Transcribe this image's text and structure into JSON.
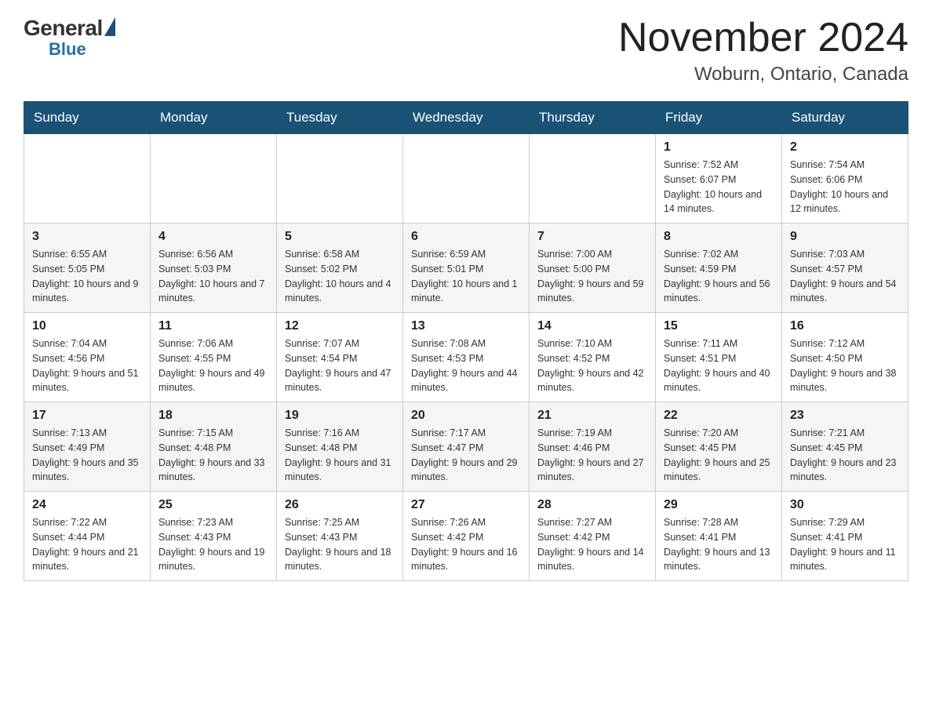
{
  "logo": {
    "general": "General",
    "blue": "Blue"
  },
  "title": {
    "month_year": "November 2024",
    "location": "Woburn, Ontario, Canada"
  },
  "weekdays": [
    "Sunday",
    "Monday",
    "Tuesday",
    "Wednesday",
    "Thursday",
    "Friday",
    "Saturday"
  ],
  "weeks": [
    [
      {
        "day": "",
        "info": ""
      },
      {
        "day": "",
        "info": ""
      },
      {
        "day": "",
        "info": ""
      },
      {
        "day": "",
        "info": ""
      },
      {
        "day": "",
        "info": ""
      },
      {
        "day": "1",
        "info": "Sunrise: 7:52 AM\nSunset: 6:07 PM\nDaylight: 10 hours and 14 minutes."
      },
      {
        "day": "2",
        "info": "Sunrise: 7:54 AM\nSunset: 6:06 PM\nDaylight: 10 hours and 12 minutes."
      }
    ],
    [
      {
        "day": "3",
        "info": "Sunrise: 6:55 AM\nSunset: 5:05 PM\nDaylight: 10 hours and 9 minutes."
      },
      {
        "day": "4",
        "info": "Sunrise: 6:56 AM\nSunset: 5:03 PM\nDaylight: 10 hours and 7 minutes."
      },
      {
        "day": "5",
        "info": "Sunrise: 6:58 AM\nSunset: 5:02 PM\nDaylight: 10 hours and 4 minutes."
      },
      {
        "day": "6",
        "info": "Sunrise: 6:59 AM\nSunset: 5:01 PM\nDaylight: 10 hours and 1 minute."
      },
      {
        "day": "7",
        "info": "Sunrise: 7:00 AM\nSunset: 5:00 PM\nDaylight: 9 hours and 59 minutes."
      },
      {
        "day": "8",
        "info": "Sunrise: 7:02 AM\nSunset: 4:59 PM\nDaylight: 9 hours and 56 minutes."
      },
      {
        "day": "9",
        "info": "Sunrise: 7:03 AM\nSunset: 4:57 PM\nDaylight: 9 hours and 54 minutes."
      }
    ],
    [
      {
        "day": "10",
        "info": "Sunrise: 7:04 AM\nSunset: 4:56 PM\nDaylight: 9 hours and 51 minutes."
      },
      {
        "day": "11",
        "info": "Sunrise: 7:06 AM\nSunset: 4:55 PM\nDaylight: 9 hours and 49 minutes."
      },
      {
        "day": "12",
        "info": "Sunrise: 7:07 AM\nSunset: 4:54 PM\nDaylight: 9 hours and 47 minutes."
      },
      {
        "day": "13",
        "info": "Sunrise: 7:08 AM\nSunset: 4:53 PM\nDaylight: 9 hours and 44 minutes."
      },
      {
        "day": "14",
        "info": "Sunrise: 7:10 AM\nSunset: 4:52 PM\nDaylight: 9 hours and 42 minutes."
      },
      {
        "day": "15",
        "info": "Sunrise: 7:11 AM\nSunset: 4:51 PM\nDaylight: 9 hours and 40 minutes."
      },
      {
        "day": "16",
        "info": "Sunrise: 7:12 AM\nSunset: 4:50 PM\nDaylight: 9 hours and 38 minutes."
      }
    ],
    [
      {
        "day": "17",
        "info": "Sunrise: 7:13 AM\nSunset: 4:49 PM\nDaylight: 9 hours and 35 minutes."
      },
      {
        "day": "18",
        "info": "Sunrise: 7:15 AM\nSunset: 4:48 PM\nDaylight: 9 hours and 33 minutes."
      },
      {
        "day": "19",
        "info": "Sunrise: 7:16 AM\nSunset: 4:48 PM\nDaylight: 9 hours and 31 minutes."
      },
      {
        "day": "20",
        "info": "Sunrise: 7:17 AM\nSunset: 4:47 PM\nDaylight: 9 hours and 29 minutes."
      },
      {
        "day": "21",
        "info": "Sunrise: 7:19 AM\nSunset: 4:46 PM\nDaylight: 9 hours and 27 minutes."
      },
      {
        "day": "22",
        "info": "Sunrise: 7:20 AM\nSunset: 4:45 PM\nDaylight: 9 hours and 25 minutes."
      },
      {
        "day": "23",
        "info": "Sunrise: 7:21 AM\nSunset: 4:45 PM\nDaylight: 9 hours and 23 minutes."
      }
    ],
    [
      {
        "day": "24",
        "info": "Sunrise: 7:22 AM\nSunset: 4:44 PM\nDaylight: 9 hours and 21 minutes."
      },
      {
        "day": "25",
        "info": "Sunrise: 7:23 AM\nSunset: 4:43 PM\nDaylight: 9 hours and 19 minutes."
      },
      {
        "day": "26",
        "info": "Sunrise: 7:25 AM\nSunset: 4:43 PM\nDaylight: 9 hours and 18 minutes."
      },
      {
        "day": "27",
        "info": "Sunrise: 7:26 AM\nSunset: 4:42 PM\nDaylight: 9 hours and 16 minutes."
      },
      {
        "day": "28",
        "info": "Sunrise: 7:27 AM\nSunset: 4:42 PM\nDaylight: 9 hours and 14 minutes."
      },
      {
        "day": "29",
        "info": "Sunrise: 7:28 AM\nSunset: 4:41 PM\nDaylight: 9 hours and 13 minutes."
      },
      {
        "day": "30",
        "info": "Sunrise: 7:29 AM\nSunset: 4:41 PM\nDaylight: 9 hours and 11 minutes."
      }
    ]
  ]
}
